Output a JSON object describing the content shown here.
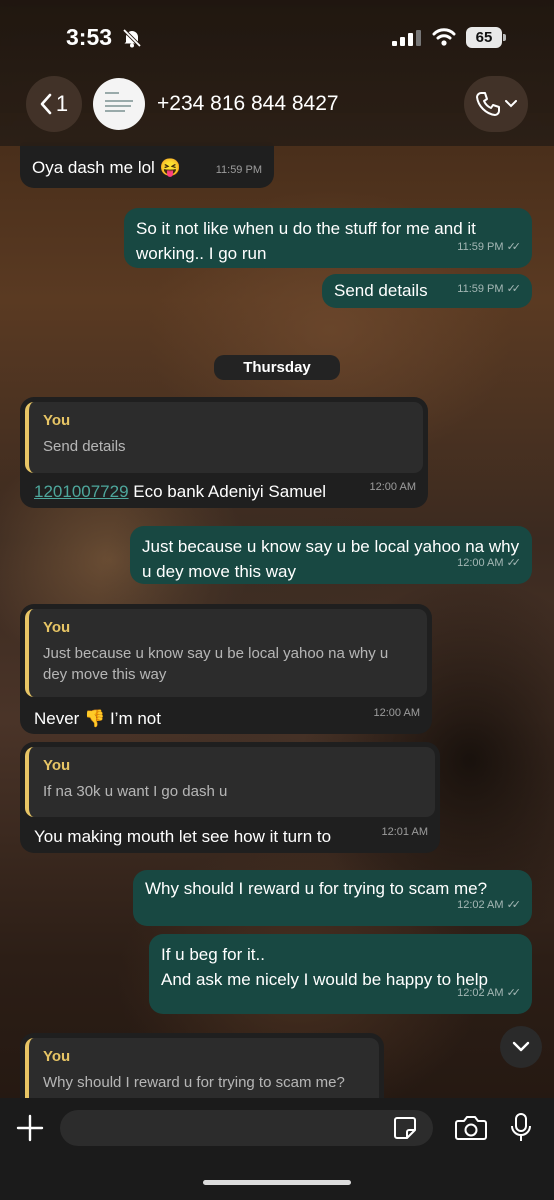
{
  "status_bar": {
    "time": "3:53",
    "battery": "65"
  },
  "header": {
    "back_count": "1",
    "contact": "+234 816 844 8427"
  },
  "messages": {
    "m1": {
      "text": "Oya dash me lol 😝",
      "time": "11:59 PM"
    },
    "m2": {
      "text": "So it not like when u do the stuff for me and it working.. I go run",
      "time": "11:59 PM"
    },
    "m3": {
      "text": "Send details",
      "time": "11:59 PM"
    },
    "day_separator": "Thursday",
    "m4": {
      "quote_author": "You",
      "quote_text": "Send details",
      "account": "1201007729",
      "text": " Eco bank Adeniyi Samuel",
      "time": "12:00 AM"
    },
    "m5": {
      "text": "Just because u know say u be local yahoo na why u dey move this way",
      "time": "12:00 AM"
    },
    "m6": {
      "quote_author": "You",
      "quote_text": "Just because u know say u be local yahoo na why u dey move this way",
      "text": "Never 👎 I’m not",
      "time": "12:00 AM"
    },
    "m7": {
      "quote_author": "You",
      "quote_text": "If na 30k u want I go dash u",
      "text": "You making mouth let see how it turn to",
      "time": "12:01 AM"
    },
    "m8": {
      "text": "Why should I reward u for trying to scam me?",
      "time": "12:02 AM"
    },
    "m9": {
      "line1": "If u beg for it..",
      "line2": "And ask me nicely I would be happy to help",
      "time": "12:02 AM"
    },
    "m10": {
      "quote_author": "You",
      "quote_text": "Why should I reward u for trying to scam me?"
    }
  },
  "icons": [
    "bell-off-icon",
    "signal-icon",
    "wifi-icon",
    "back-chevron-icon",
    "phone-icon",
    "chevron-down-icon",
    "plus-icon",
    "sticker-icon",
    "camera-icon",
    "microphone-icon"
  ],
  "colors": {
    "outgoing_bubble": "#184842",
    "incoming_bubble": "#1f1f1f",
    "quote_accent": "#e7c565",
    "link": "#4ea79c"
  }
}
